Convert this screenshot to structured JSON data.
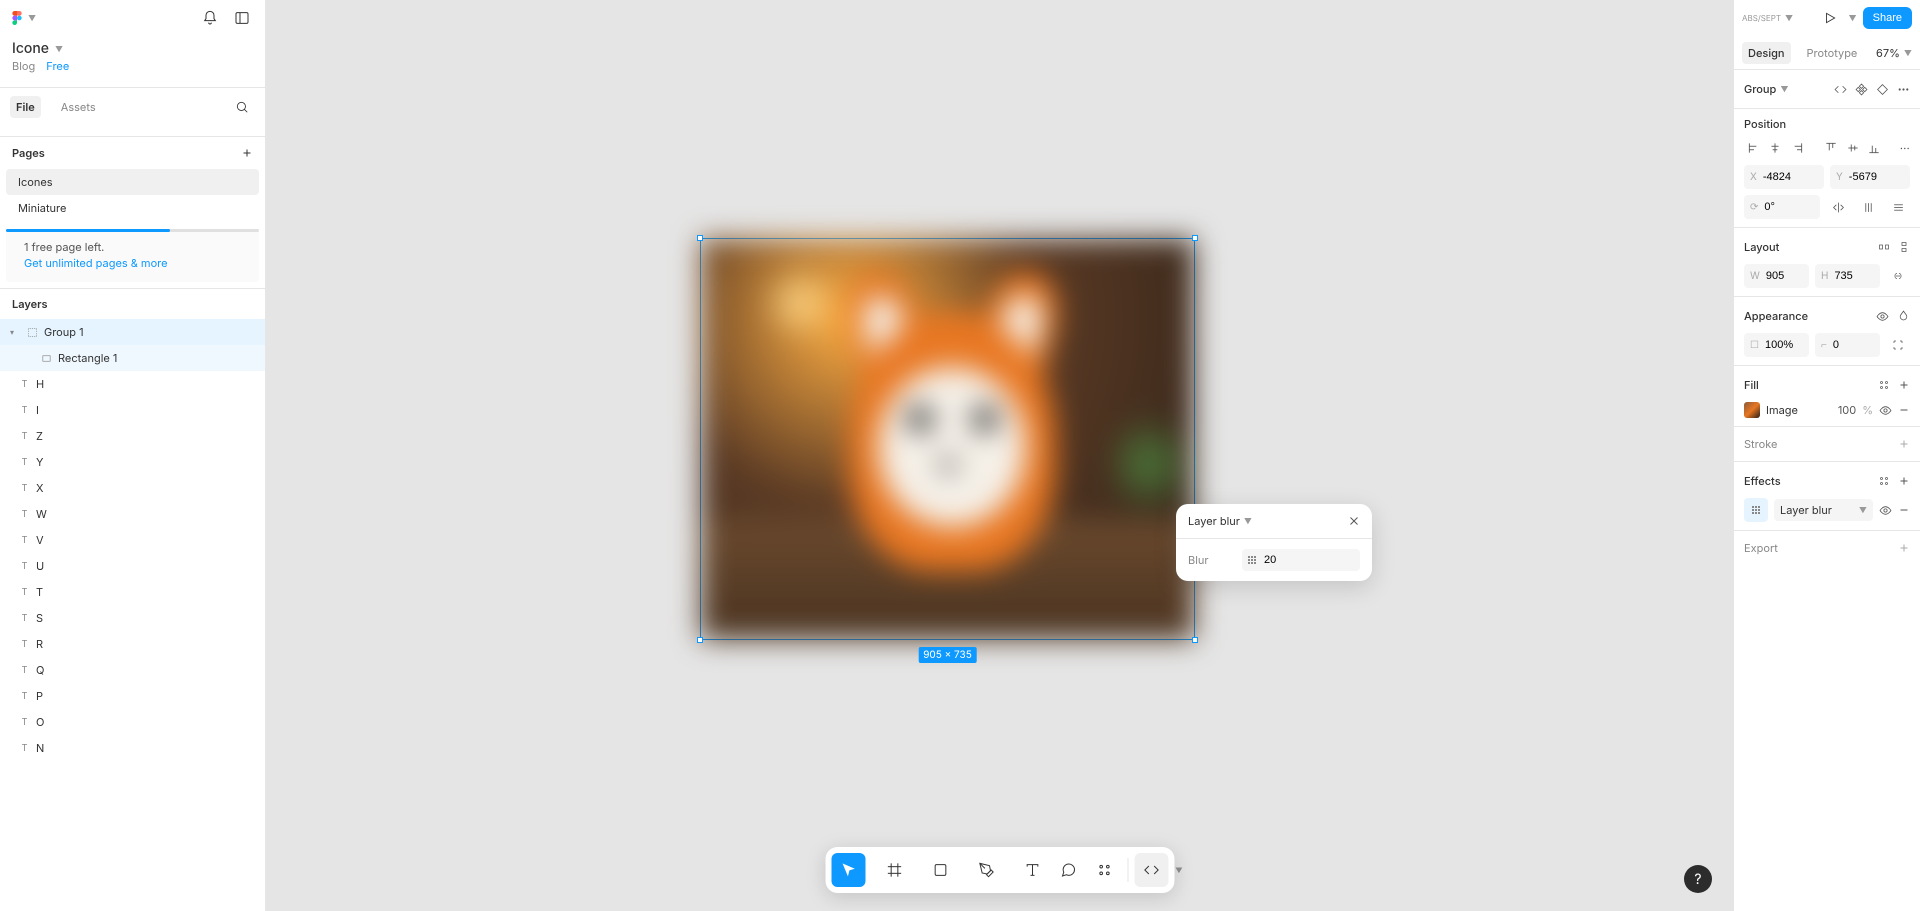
{
  "file": {
    "title": "Icone",
    "blog": "Blog",
    "tier": "Free"
  },
  "fileTabs": {
    "file": "File",
    "assets": "Assets"
  },
  "pages": {
    "head": "Pages",
    "items": [
      "Icones",
      "Miniature"
    ],
    "activeIndex": 0
  },
  "freePage": {
    "line1": "1 free page left.",
    "line2": "Get unlimited pages & more"
  },
  "layersHead": "Layers",
  "layers": {
    "group": "Group 1",
    "child": "Rectangle 1",
    "textLayers": [
      "H",
      "I",
      "Z",
      "Y",
      "X",
      "W",
      "V",
      "U",
      "T",
      "S",
      "R",
      "Q",
      "P",
      "O",
      "N"
    ]
  },
  "canvas": {
    "dimLabel": "905 × 735"
  },
  "popover": {
    "title": "Layer blur",
    "blurLabel": "Blur",
    "blurValue": "20"
  },
  "rightTop": {
    "avatar": "ABS/SEPT",
    "share": "Share"
  },
  "rightTabs": {
    "design": "Design",
    "prototype": "Prototype",
    "zoom": "67%"
  },
  "selection": {
    "type": "Group"
  },
  "position": {
    "title": "Position",
    "x": "-4824",
    "y": "-5679",
    "rotation": "0°"
  },
  "layout": {
    "title": "Layout",
    "w": "905",
    "h": "735"
  },
  "appearance": {
    "title": "Appearance",
    "opacity": "100%",
    "radius": "0"
  },
  "fill": {
    "title": "Fill",
    "type": "Image",
    "pct": "100",
    "unit": "%"
  },
  "stroke": {
    "title": "Stroke"
  },
  "effects": {
    "title": "Effects",
    "type": "Layer blur"
  },
  "export": {
    "title": "Export"
  }
}
